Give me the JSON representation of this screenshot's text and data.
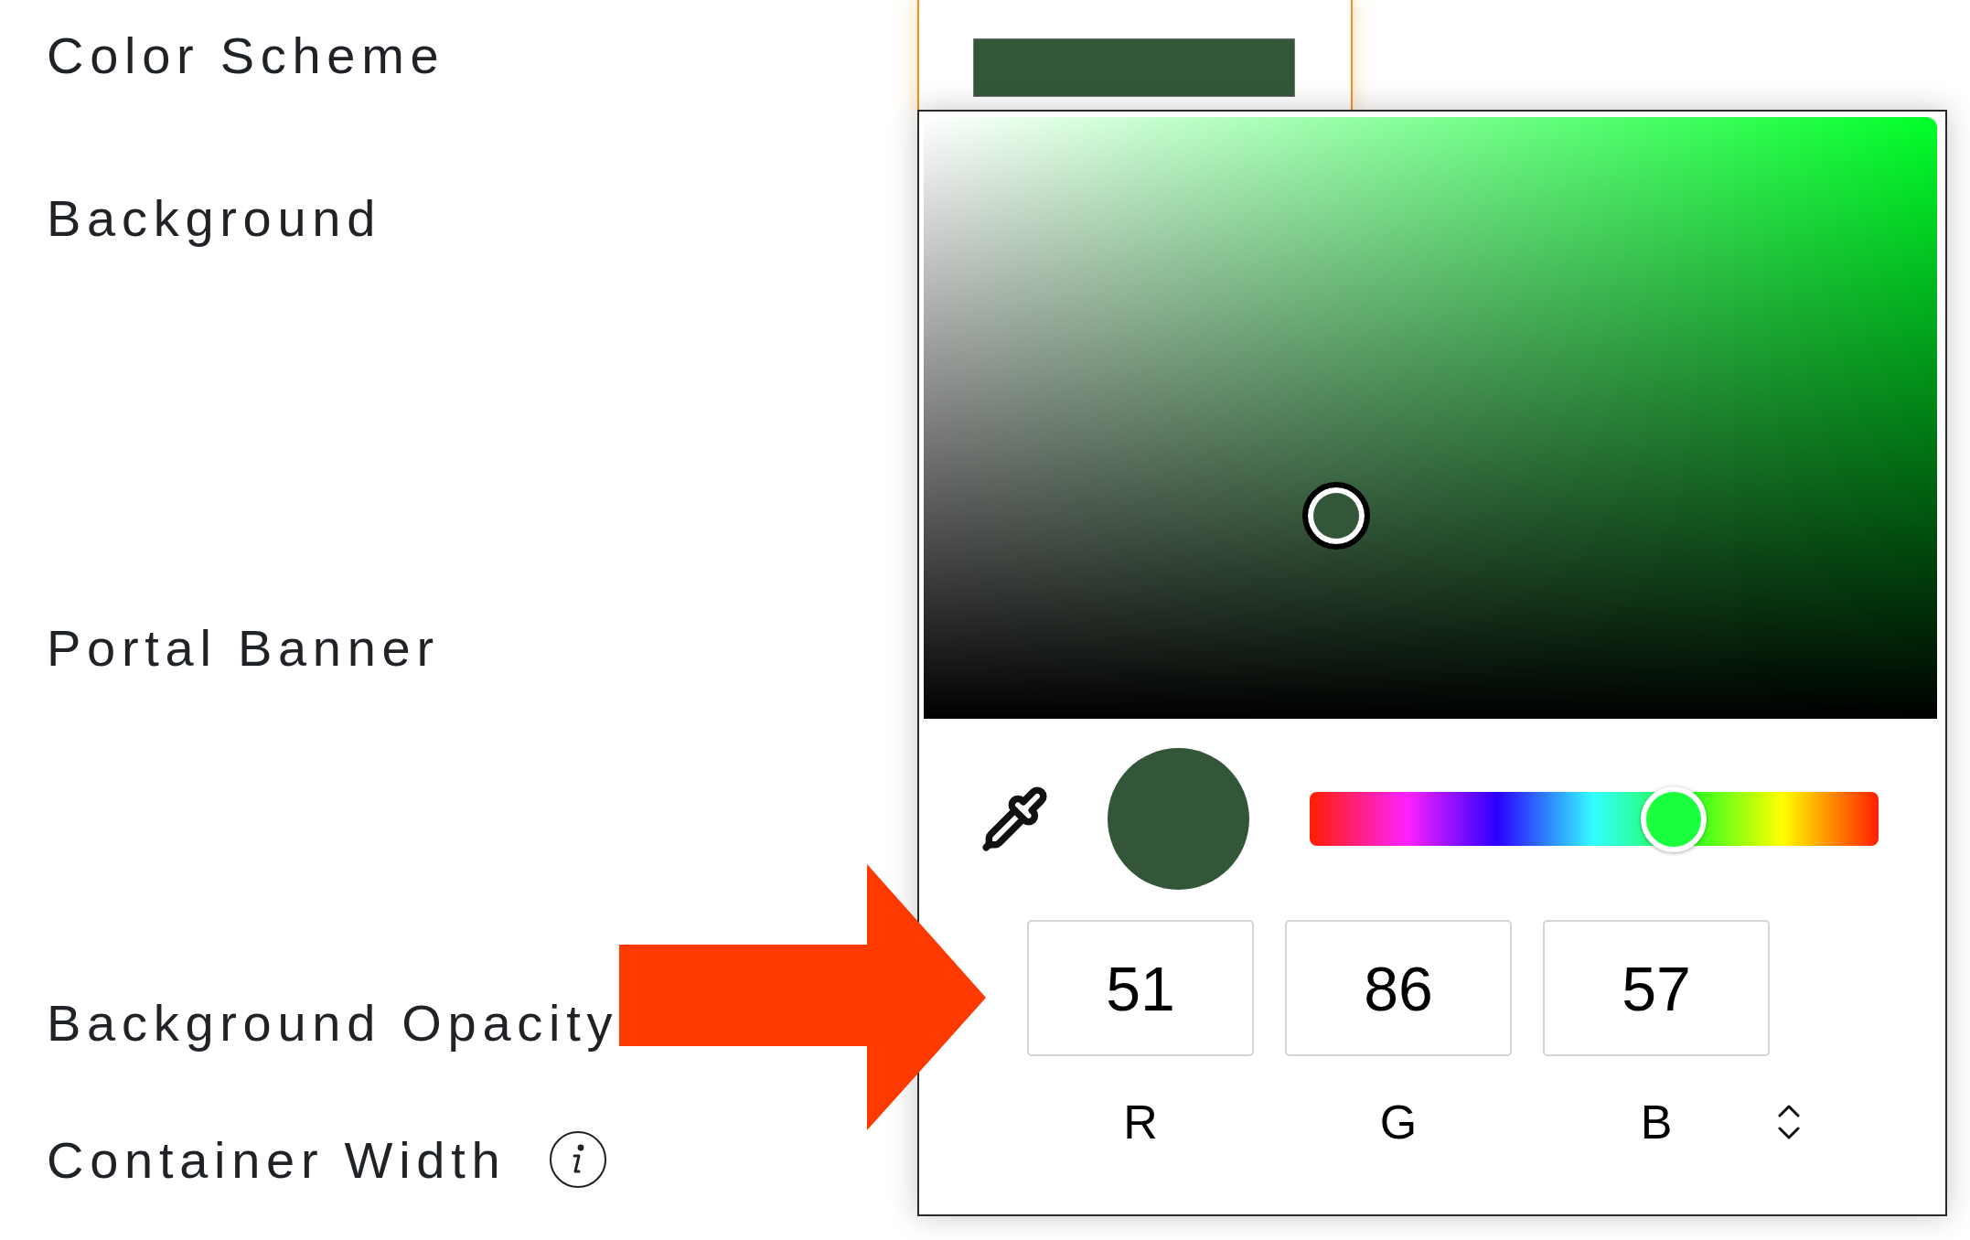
{
  "settings": [
    {
      "label": "Color Scheme",
      "info": false
    },
    {
      "label": "Background",
      "info": false
    },
    {
      "label": "Portal Banner",
      "info": false
    },
    {
      "label": "Background Opacity",
      "info": false
    },
    {
      "label": "Container Width",
      "info": true
    }
  ],
  "color_scheme": {
    "color": "#335639"
  },
  "color_picker": {
    "color": "#335639",
    "hue_slider": {
      "level": 0.64
    },
    "channels": [
      {
        "value": "51",
        "label": "R"
      },
      {
        "value": "86",
        "label": "G"
      },
      {
        "value": "57",
        "label": "B"
      }
    ]
  }
}
